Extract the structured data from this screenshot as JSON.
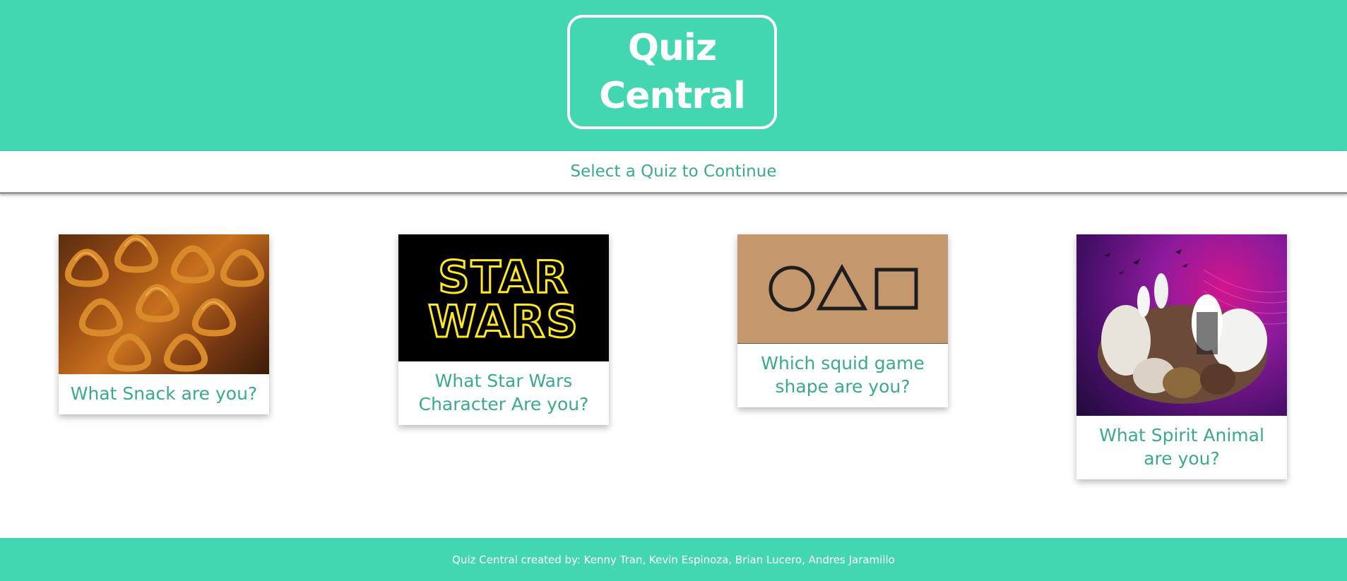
{
  "header": {
    "logo_line1": "Quiz",
    "logo_line2": "Central"
  },
  "subnav": {
    "text": "Select a Quiz to Continue"
  },
  "cards": [
    {
      "title": "What Snack are you?",
      "image": "pretzels-image"
    },
    {
      "title": "What Star Wars Character Are you?",
      "image": "star-wars-logo-image",
      "logo_line1": "STAR",
      "logo_line2": "WARS"
    },
    {
      "title": "Which squid game shape are you?",
      "image": "squid-game-shapes-image"
    },
    {
      "title": "What Spirit Animal are you?",
      "image": "animals-collage-image"
    }
  ],
  "footer": {
    "text": "Quiz Central created by: Kenny Tran, Kevin Espinoza, Brian Lucero, Andres Jaramillo"
  },
  "colors": {
    "brand": "#42d6b1",
    "title_text": "#3aa98d",
    "white": "#ffffff"
  }
}
